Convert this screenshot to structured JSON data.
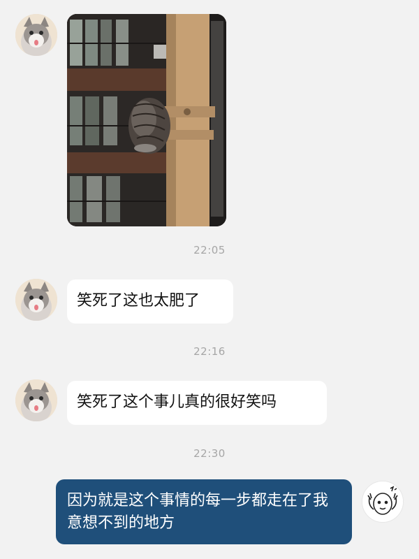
{
  "messages": [
    {
      "side": "left",
      "type": "image"
    },
    {
      "time": "22:05"
    },
    {
      "side": "left",
      "type": "text",
      "text": "笑死了这也太肥了"
    },
    {
      "time": "22:16"
    },
    {
      "side": "left",
      "type": "text",
      "text": "笑死了这个事儿真的很好笑吗"
    },
    {
      "time": "22:30"
    },
    {
      "side": "right",
      "type": "text",
      "text": "因为就是这个事情的每一步都走在了我意想不到的地方"
    }
  ],
  "colors": {
    "background": "#f2f2f2",
    "incoming_bubble": "#ffffff",
    "outgoing_bubble": "#1f4f7a",
    "timestamp": "#a6a6a6"
  },
  "icons": {
    "incoming_avatar": "cat-avatar",
    "outgoing_avatar": "doodle-face-avatar"
  }
}
